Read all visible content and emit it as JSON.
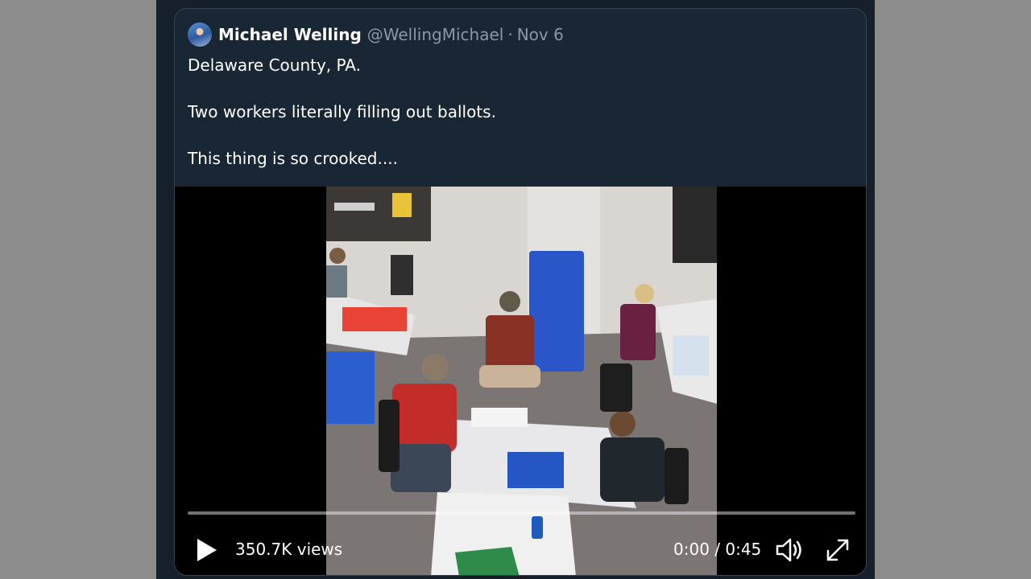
{
  "tweet": {
    "author_name": "Michael Welling",
    "author_handle": "@WellingMichael",
    "separator": "·",
    "date": "Nov 6",
    "lines": [
      "Delaware County, PA.",
      "Two workers literally filling out ballots.",
      "This thing is so crooked...."
    ]
  },
  "video": {
    "views": "350.7K views",
    "time": "0:00 / 0:45",
    "progress": 0
  },
  "icons": {
    "play": "play-icon",
    "volume": "volume-icon",
    "fullscreen": "fullscreen-icon"
  },
  "colors": {
    "card_bg": "#192734",
    "page_bg": "#15202b",
    "secondary_text": "#8899a6"
  }
}
